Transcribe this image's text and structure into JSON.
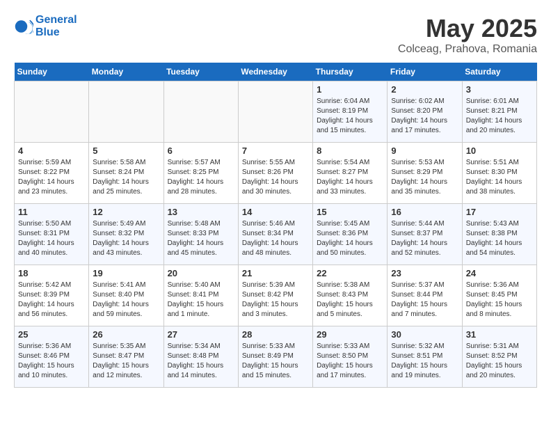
{
  "header": {
    "logo_line1": "General",
    "logo_line2": "Blue",
    "month": "May 2025",
    "location": "Colceag, Prahova, Romania"
  },
  "weekdays": [
    "Sunday",
    "Monday",
    "Tuesday",
    "Wednesday",
    "Thursday",
    "Friday",
    "Saturday"
  ],
  "weeks": [
    [
      {
        "day": "",
        "info": ""
      },
      {
        "day": "",
        "info": ""
      },
      {
        "day": "",
        "info": ""
      },
      {
        "day": "",
        "info": ""
      },
      {
        "day": "1",
        "info": "Sunrise: 6:04 AM\nSunset: 8:19 PM\nDaylight: 14 hours\nand 15 minutes."
      },
      {
        "day": "2",
        "info": "Sunrise: 6:02 AM\nSunset: 8:20 PM\nDaylight: 14 hours\nand 17 minutes."
      },
      {
        "day": "3",
        "info": "Sunrise: 6:01 AM\nSunset: 8:21 PM\nDaylight: 14 hours\nand 20 minutes."
      }
    ],
    [
      {
        "day": "4",
        "info": "Sunrise: 5:59 AM\nSunset: 8:22 PM\nDaylight: 14 hours\nand 23 minutes."
      },
      {
        "day": "5",
        "info": "Sunrise: 5:58 AM\nSunset: 8:24 PM\nDaylight: 14 hours\nand 25 minutes."
      },
      {
        "day": "6",
        "info": "Sunrise: 5:57 AM\nSunset: 8:25 PM\nDaylight: 14 hours\nand 28 minutes."
      },
      {
        "day": "7",
        "info": "Sunrise: 5:55 AM\nSunset: 8:26 PM\nDaylight: 14 hours\nand 30 minutes."
      },
      {
        "day": "8",
        "info": "Sunrise: 5:54 AM\nSunset: 8:27 PM\nDaylight: 14 hours\nand 33 minutes."
      },
      {
        "day": "9",
        "info": "Sunrise: 5:53 AM\nSunset: 8:29 PM\nDaylight: 14 hours\nand 35 minutes."
      },
      {
        "day": "10",
        "info": "Sunrise: 5:51 AM\nSunset: 8:30 PM\nDaylight: 14 hours\nand 38 minutes."
      }
    ],
    [
      {
        "day": "11",
        "info": "Sunrise: 5:50 AM\nSunset: 8:31 PM\nDaylight: 14 hours\nand 40 minutes."
      },
      {
        "day": "12",
        "info": "Sunrise: 5:49 AM\nSunset: 8:32 PM\nDaylight: 14 hours\nand 43 minutes."
      },
      {
        "day": "13",
        "info": "Sunrise: 5:48 AM\nSunset: 8:33 PM\nDaylight: 14 hours\nand 45 minutes."
      },
      {
        "day": "14",
        "info": "Sunrise: 5:46 AM\nSunset: 8:34 PM\nDaylight: 14 hours\nand 48 minutes."
      },
      {
        "day": "15",
        "info": "Sunrise: 5:45 AM\nSunset: 8:36 PM\nDaylight: 14 hours\nand 50 minutes."
      },
      {
        "day": "16",
        "info": "Sunrise: 5:44 AM\nSunset: 8:37 PM\nDaylight: 14 hours\nand 52 minutes."
      },
      {
        "day": "17",
        "info": "Sunrise: 5:43 AM\nSunset: 8:38 PM\nDaylight: 14 hours\nand 54 minutes."
      }
    ],
    [
      {
        "day": "18",
        "info": "Sunrise: 5:42 AM\nSunset: 8:39 PM\nDaylight: 14 hours\nand 56 minutes."
      },
      {
        "day": "19",
        "info": "Sunrise: 5:41 AM\nSunset: 8:40 PM\nDaylight: 14 hours\nand 59 minutes."
      },
      {
        "day": "20",
        "info": "Sunrise: 5:40 AM\nSunset: 8:41 PM\nDaylight: 15 hours\nand 1 minute."
      },
      {
        "day": "21",
        "info": "Sunrise: 5:39 AM\nSunset: 8:42 PM\nDaylight: 15 hours\nand 3 minutes."
      },
      {
        "day": "22",
        "info": "Sunrise: 5:38 AM\nSunset: 8:43 PM\nDaylight: 15 hours\nand 5 minutes."
      },
      {
        "day": "23",
        "info": "Sunrise: 5:37 AM\nSunset: 8:44 PM\nDaylight: 15 hours\nand 7 minutes."
      },
      {
        "day": "24",
        "info": "Sunrise: 5:36 AM\nSunset: 8:45 PM\nDaylight: 15 hours\nand 8 minutes."
      }
    ],
    [
      {
        "day": "25",
        "info": "Sunrise: 5:36 AM\nSunset: 8:46 PM\nDaylight: 15 hours\nand 10 minutes."
      },
      {
        "day": "26",
        "info": "Sunrise: 5:35 AM\nSunset: 8:47 PM\nDaylight: 15 hours\nand 12 minutes."
      },
      {
        "day": "27",
        "info": "Sunrise: 5:34 AM\nSunset: 8:48 PM\nDaylight: 15 hours\nand 14 minutes."
      },
      {
        "day": "28",
        "info": "Sunrise: 5:33 AM\nSunset: 8:49 PM\nDaylight: 15 hours\nand 15 minutes."
      },
      {
        "day": "29",
        "info": "Sunrise: 5:33 AM\nSunset: 8:50 PM\nDaylight: 15 hours\nand 17 minutes."
      },
      {
        "day": "30",
        "info": "Sunrise: 5:32 AM\nSunset: 8:51 PM\nDaylight: 15 hours\nand 19 minutes."
      },
      {
        "day": "31",
        "info": "Sunrise: 5:31 AM\nSunset: 8:52 PM\nDaylight: 15 hours\nand 20 minutes."
      }
    ]
  ]
}
